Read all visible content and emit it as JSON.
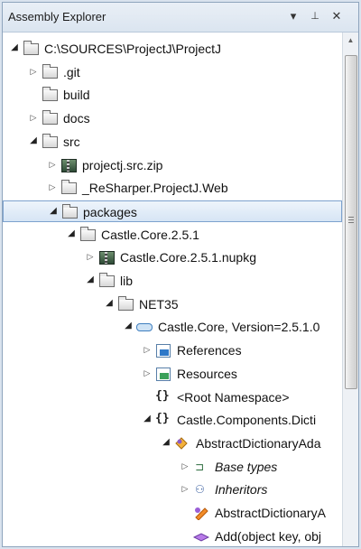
{
  "window": {
    "title": "Assembly Explorer",
    "dropdown_glyph": "▾",
    "pin_glyph": "ᚴ",
    "close_glyph": "✕"
  },
  "tree": [
    {
      "label": "C:\\SOURCES\\ProjectJ\\ProjectJ",
      "depth": 0,
      "expander": "open",
      "icon": "project-folder-icon"
    },
    {
      "label": ".git",
      "depth": 1,
      "expander": "closed",
      "icon": "folder-icon"
    },
    {
      "label": "build",
      "depth": 1,
      "expander": "none",
      "icon": "folder-icon"
    },
    {
      "label": "docs",
      "depth": 1,
      "expander": "closed",
      "icon": "folder-icon"
    },
    {
      "label": "src",
      "depth": 1,
      "expander": "open",
      "icon": "folder-icon"
    },
    {
      "label": "projectj.src.zip",
      "depth": 2,
      "expander": "closed",
      "icon": "zip-icon"
    },
    {
      "label": "_ReSharper.ProjectJ.Web",
      "depth": 2,
      "expander": "closed",
      "icon": "folder-icon"
    },
    {
      "label": "packages",
      "depth": 2,
      "expander": "open",
      "icon": "folder-icon",
      "selected": true
    },
    {
      "label": "Castle.Core.2.5.1",
      "depth": 3,
      "expander": "open",
      "icon": "folder-icon"
    },
    {
      "label": "Castle.Core.2.5.1.nupkg",
      "depth": 4,
      "expander": "closed",
      "icon": "package-icon"
    },
    {
      "label": "lib",
      "depth": 4,
      "expander": "open",
      "icon": "folder-icon"
    },
    {
      "label": "NET35",
      "depth": 5,
      "expander": "open",
      "icon": "folder-icon"
    },
    {
      "label": "Castle.Core, Version=2.5.1.0",
      "depth": 6,
      "expander": "open",
      "icon": "assembly-icon"
    },
    {
      "label": "References",
      "depth": 7,
      "expander": "closed",
      "icon": "references-icon"
    },
    {
      "label": "Resources",
      "depth": 7,
      "expander": "closed",
      "icon": "resources-icon"
    },
    {
      "label": "<Root Namespace>",
      "depth": 7,
      "expander": "none",
      "icon": "namespace-icon"
    },
    {
      "label": "Castle.Components.Dicti",
      "depth": 7,
      "expander": "open",
      "icon": "namespace-icon"
    },
    {
      "label": "AbstractDictionaryAda",
      "depth": 8,
      "expander": "open",
      "icon": "class-icon"
    },
    {
      "label": "Base types",
      "depth": 9,
      "expander": "closed",
      "icon": "base-types-icon",
      "italic": true
    },
    {
      "label": "Inheritors",
      "depth": 9,
      "expander": "closed",
      "icon": "inheritors-icon",
      "italic": true
    },
    {
      "label": "AbstractDictionaryA",
      "depth": 9,
      "expander": "none",
      "icon": "constructor-icon"
    },
    {
      "label": "Add(object key, obj",
      "depth": 9,
      "expander": "none",
      "icon": "method-icon"
    }
  ],
  "colors": {
    "selection_border": "#7da2ce",
    "panel_bg": "#ffffff",
    "chrome_bg": "#d9e3ee"
  }
}
